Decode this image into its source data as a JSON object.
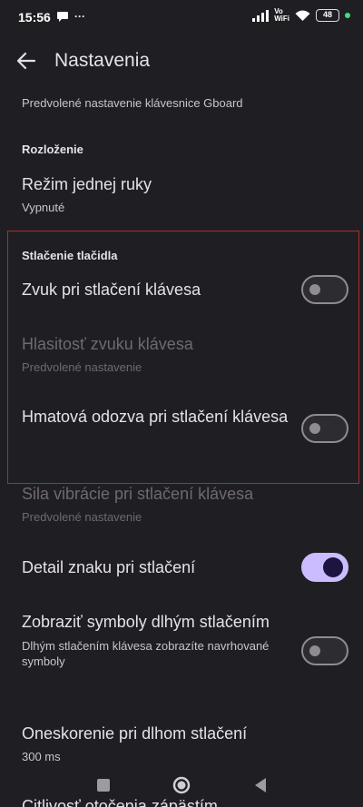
{
  "status": {
    "time": "15:56",
    "battery": "48",
    "vowifi_top": "Vo",
    "vowifi_bottom": "WiFi",
    "more": "···"
  },
  "app_bar": {
    "title": "Nastavenia"
  },
  "settings": {
    "top_subtitle": "Predvolené nastavenie klávesnice Gboard",
    "layout_header": "Rozloženie",
    "one_hand_title": "Režim jednej ruky",
    "one_hand_subtitle": "Vypnuté",
    "keypress_header": "Stlačenie tlačidla",
    "sound_title": "Zvuk pri stlačení klávesa",
    "sound_enabled": false,
    "volume_title": "Hlasitosť zvuku klávesa",
    "volume_subtitle": "Predvolené nastavenie",
    "haptic_title": "Hmatová odozva pri stlačení klávesa",
    "haptic_enabled": false,
    "vibration_title": "Sila vibrácie pri stlačení klávesa",
    "vibration_subtitle": "Predvolené nastavenie",
    "popup_title": "Detail znaku pri stlačení",
    "popup_enabled": true,
    "longpress_symbols_title": "Zobraziť symboly dlhým stlačením",
    "longpress_symbols_subtitle": "Dlhým stlačením klávesa zobrazíte navrhované symboly",
    "longpress_symbols_enabled": false,
    "longpress_delay_title": "Oneskorenie pri dlhom stlačení",
    "longpress_delay_value": "300 ms",
    "wrist_title": "Citlivosť otočenia zápästím"
  },
  "colors": {
    "background": "#1f1f23",
    "accent": "#cbbcff",
    "highlight_box": "#b12a2a"
  },
  "nav_icons": [
    "recents-icon",
    "home-icon",
    "back-triangle-icon"
  ]
}
